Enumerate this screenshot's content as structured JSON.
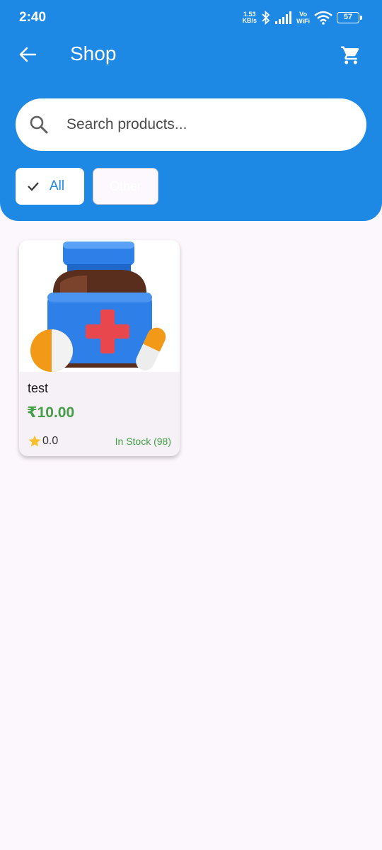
{
  "status_bar": {
    "time": "2:40",
    "net_speed_value": "1.53",
    "net_speed_unit": "KB/s",
    "vowifi_top": "Vo",
    "vowifi_bottom": "WiFi",
    "battery": "57",
    "icons": [
      "bluetooth-icon",
      "signal-icon",
      "wifi-icon"
    ]
  },
  "app_bar": {
    "title": "Shop",
    "back_icon": "arrow-left-icon",
    "cart_icon": "cart-icon"
  },
  "search": {
    "placeholder": "Search products...",
    "value": ""
  },
  "filters": {
    "chips": [
      {
        "label": "All",
        "selected": true
      },
      {
        "label": "Other",
        "selected": false
      }
    ]
  },
  "products": [
    {
      "name": "test",
      "price": "₹10.00",
      "rating": "0.0",
      "stock": "In Stock (98)"
    }
  ],
  "colors": {
    "primary": "#1e88e5",
    "background": "#fcf6fd",
    "price_green": "#43a047",
    "star": "#fbc02d"
  }
}
